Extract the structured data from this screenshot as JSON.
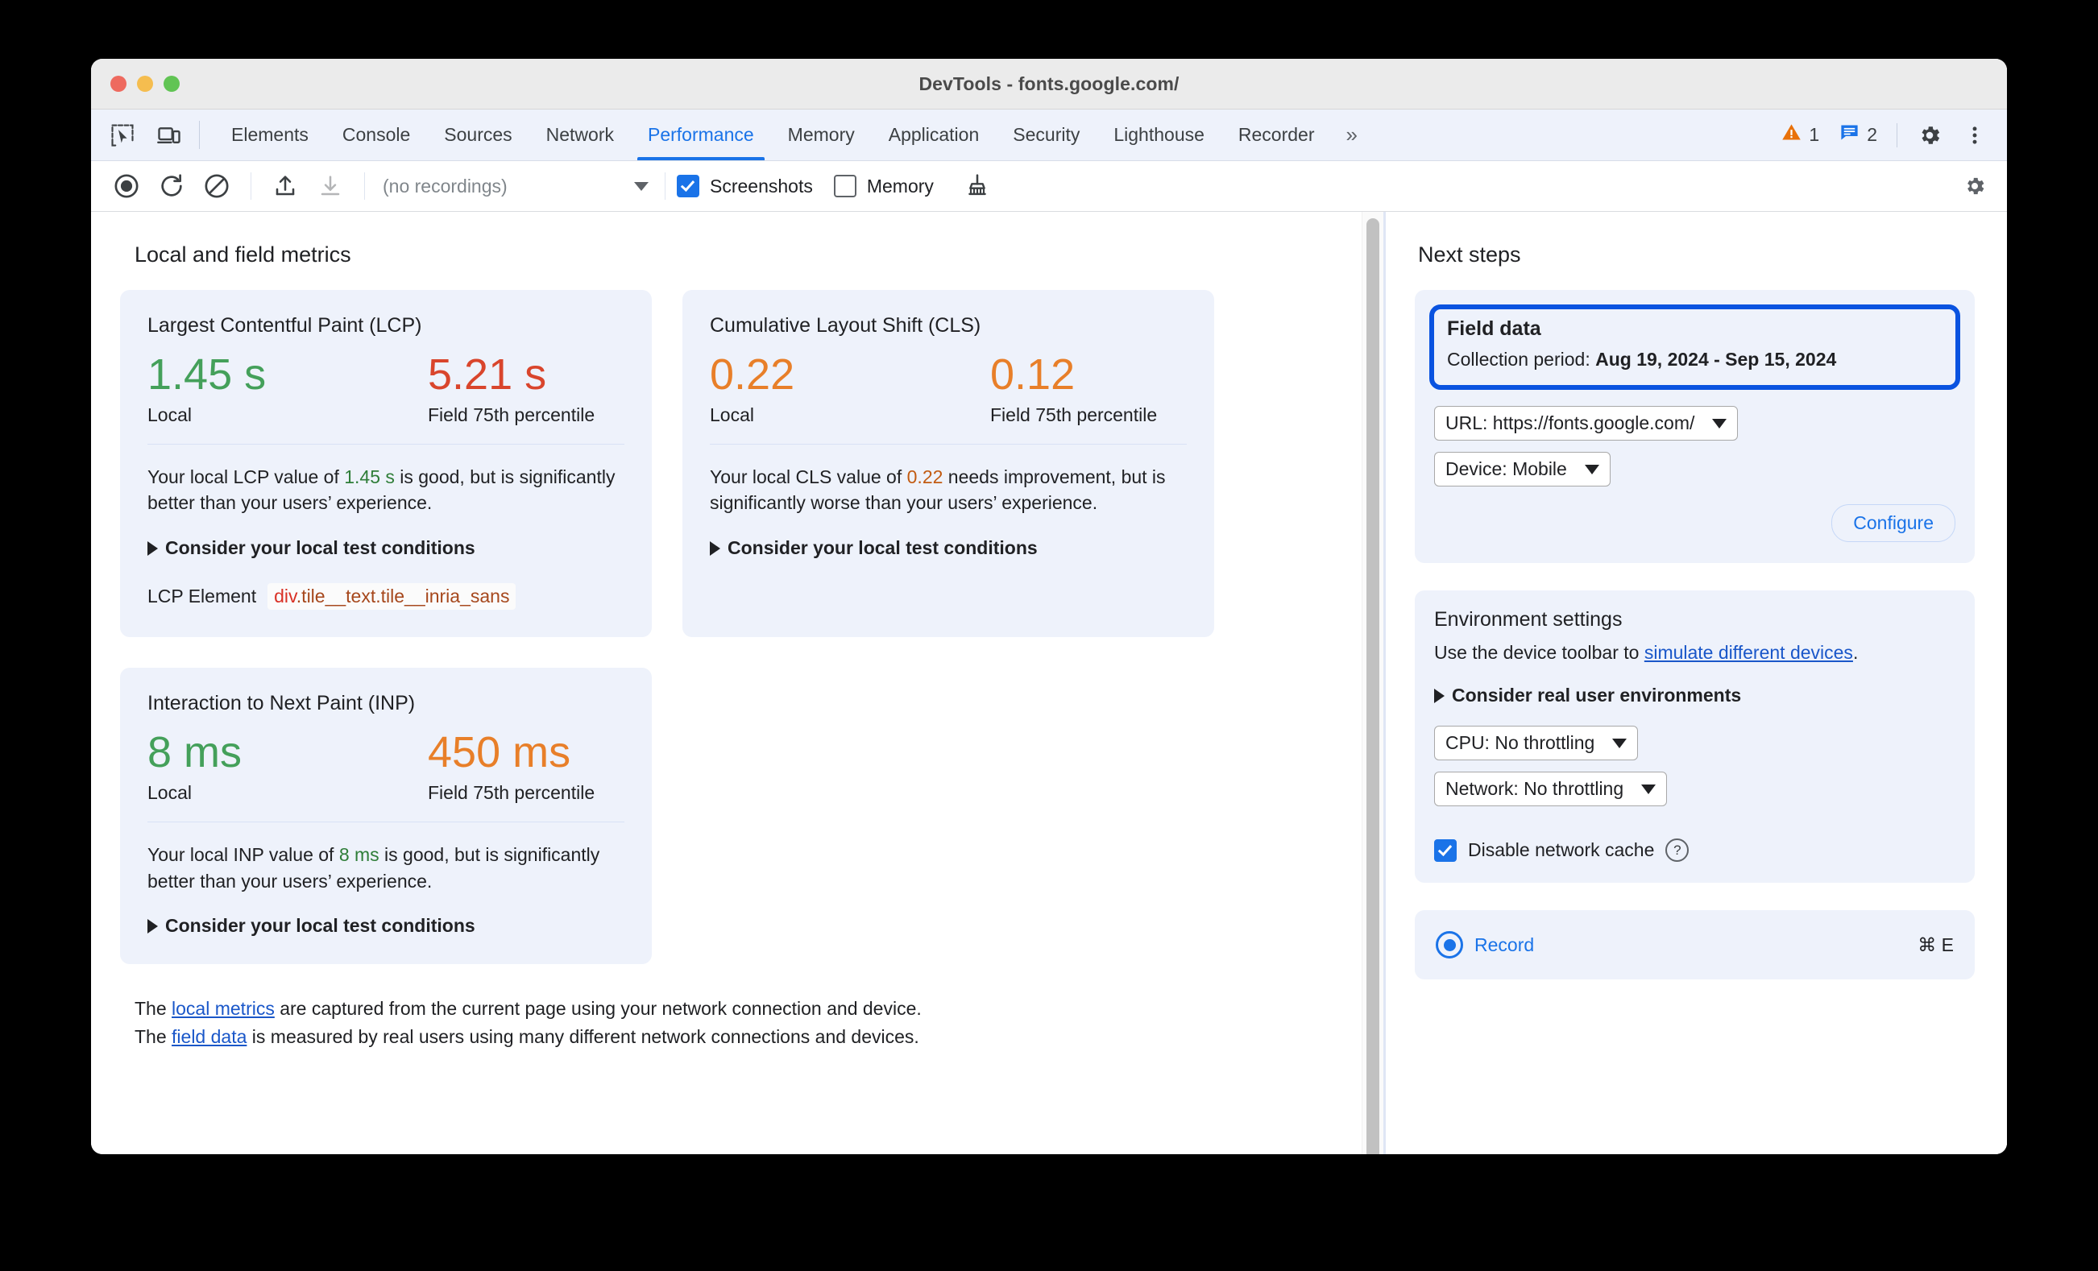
{
  "window": {
    "title": "DevTools - fonts.google.com/"
  },
  "tabbar": {
    "inspect_icon": "inspect-cursor-icon",
    "device_icon": "device-toolbar-icon",
    "tabs": [
      {
        "label": "Elements",
        "active": false
      },
      {
        "label": "Console",
        "active": false
      },
      {
        "label": "Sources",
        "active": false
      },
      {
        "label": "Network",
        "active": false
      },
      {
        "label": "Performance",
        "active": true
      },
      {
        "label": "Memory",
        "active": false
      },
      {
        "label": "Application",
        "active": false
      },
      {
        "label": "Security",
        "active": false
      },
      {
        "label": "Lighthouse",
        "active": false
      },
      {
        "label": "Recorder",
        "active": false
      }
    ],
    "more_label": "»",
    "warning_count": "1",
    "info_count": "2",
    "settings_icon": "gear-icon",
    "menu_icon": "kebab-menu-icon",
    "warning_icon": "warning-triangle-icon",
    "message_icon": "message-icon",
    "warning_color": "#e8710a",
    "message_color": "#1a73e8"
  },
  "toolbar": {
    "record_icon": "record-circle-icon",
    "reload_record_icon": "reload-record-icon",
    "clear_icon": "clear-prohibited-icon",
    "upload_icon": "upload-profile-icon",
    "download_icon": "download-profile-icon",
    "recordings_value": "(no recordings)",
    "screenshots_label": "Screenshots",
    "screenshots_checked": true,
    "memory_label": "Memory",
    "memory_checked": false,
    "collect_garbage_icon": "broom-icon",
    "settings_icon": "gear-icon"
  },
  "main": {
    "section_title": "Local and field metrics",
    "metrics": [
      {
        "name": "lcp",
        "title": "Largest Contentful Paint (LCP)",
        "local_value": "1.45 s",
        "local_status": "good",
        "local_label": "Local",
        "field_value": "5.21 s",
        "field_status": "bad",
        "field_label": "Field 75th percentile",
        "desc_prefix": "Your local LCP value of ",
        "desc_value": "1.45 s",
        "desc_value_status": "good",
        "desc_suffix": " is good, but is significantly better than your users’ experience.",
        "disclosure": "Consider your local test conditions",
        "element_label": "LCP Element",
        "element_tag": "div",
        "element_classes": ".tile__text.tile__inria_sans"
      },
      {
        "name": "cls",
        "title": "Cumulative Layout Shift (CLS)",
        "local_value": "0.22",
        "local_status": "warn",
        "local_label": "Local",
        "field_value": "0.12",
        "field_status": "warn",
        "field_label": "Field 75th percentile",
        "desc_prefix": "Your local CLS value of ",
        "desc_value": "0.22",
        "desc_value_status": "warn",
        "desc_suffix": " needs improvement, but is significantly worse than your users’ experience.",
        "disclosure": "Consider your local test conditions"
      },
      {
        "name": "inp",
        "title": "Interaction to Next Paint (INP)",
        "local_value": "8 ms",
        "local_status": "good",
        "local_label": "Local",
        "field_value": "450 ms",
        "field_status": "warn",
        "field_label": "Field 75th percentile",
        "desc_prefix": "Your local INP value of ",
        "desc_value": "8 ms",
        "desc_value_status": "good",
        "desc_suffix": " is good, but is significantly better than your users’ experience.",
        "disclosure": "Consider your local test conditions"
      }
    ],
    "footnote": {
      "line1_pre": "The ",
      "line1_link": "local metrics",
      "line1_post": " are captured from the current page using your network connection and device.",
      "line2_pre": "The ",
      "line2_link": "field data",
      "line2_post": " is measured by real users using many different network connections and devices."
    }
  },
  "side": {
    "title": "Next steps",
    "field_data": {
      "heading": "Field data",
      "collection_label": "Collection period: ",
      "collection_value": "Aug 19, 2024 - Sep 15, 2024",
      "url_select": "URL: https://fonts.google.com/",
      "device_select": "Device: Mobile",
      "configure_button": "Configure",
      "focus_color": "#0a53e0"
    },
    "environment": {
      "heading": "Environment settings",
      "desc_pre": "Use the device toolbar to ",
      "desc_link": "simulate different devices",
      "desc_post": ".",
      "disclosure": "Consider real user environments",
      "cpu_select": "CPU: No throttling",
      "network_select": "Network: No throttling",
      "disable_cache_label": "Disable network cache",
      "disable_cache_checked": true,
      "help_icon": "question-mark-icon"
    },
    "record": {
      "label": "Record",
      "shortcut": "⌘ E",
      "icon": "record-circle-icon"
    }
  }
}
